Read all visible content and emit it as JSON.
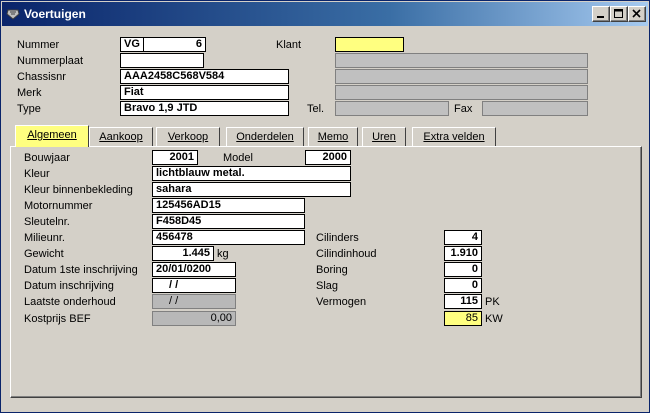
{
  "window": {
    "title": "Voertuigen"
  },
  "header": {
    "nummer_label": "Nummer",
    "nummer_prefix": "VG",
    "nummer_value": "6",
    "klant_label": "Klant",
    "klant_value": "",
    "nummerplaat_label": "Nummerplaat",
    "nummerplaat_value": "",
    "chassisnr_label": "Chassisnr",
    "chassisnr_value": "AAA2458C568V584",
    "merk_label": "Merk",
    "merk_value": "Fiat",
    "type_label": "Type",
    "type_value": "Bravo 1,9 JTD",
    "tel_label": "Tel.",
    "tel_value": "",
    "fax_label": "Fax",
    "fax_value": ""
  },
  "tabs": [
    {
      "label": "Algemeen",
      "active": true
    },
    {
      "label": "Aankoop"
    },
    {
      "label": "Verkoop"
    },
    {
      "label": "Onderdelen"
    },
    {
      "label": "Memo"
    },
    {
      "label": "Uren"
    },
    {
      "label": "Extra velden"
    }
  ],
  "general": {
    "bouwjaar_label": "Bouwjaar",
    "bouwjaar_value": "2001",
    "model_label": "Model",
    "model_value": "2000",
    "kleur_label": "Kleur",
    "kleur_value": "lichtblauw metal.",
    "kleur_binnen_label": "Kleur binnenbekleding",
    "kleur_binnen_value": "sahara",
    "motornummer_label": "Motornummer",
    "motornummer_value": "125456AD15",
    "sleutelnr_label": "Sleutelnr.",
    "sleutelnr_value": "F458D45",
    "milieunr_label": "Milieunr.",
    "milieunr_value": "456478",
    "gewicht_label": "Gewicht",
    "gewicht_value": "1.445",
    "gewicht_unit": "kg",
    "datum1_label": "Datum 1ste inschrijving",
    "datum1_value": "20/01/0200",
    "datum_insch_label": "Datum inschrijving",
    "datum_insch_value": "/ /",
    "laatste_label": "Laatste onderhoud",
    "laatste_value": "/ /",
    "kostprijs_label": "Kostprijs BEF",
    "kostprijs_value": "0,00",
    "cilinders_label": "Cilinders",
    "cilinders_value": "4",
    "cilindinhoud_label": "Cilindinhoud",
    "cilindinhoud_value": "1.910",
    "boring_label": "Boring",
    "boring_value": "0",
    "slag_label": "Slag",
    "slag_value": "0",
    "vermogen_label": "Vermogen",
    "vermogen_pk_value": "115",
    "vermogen_pk_unit": "PK",
    "vermogen_kw_value": "85",
    "vermogen_kw_unit": "KW"
  },
  "colors": {
    "title_start": "#0a246a",
    "highlight": "#ffff80",
    "face": "#d4d0c8"
  }
}
